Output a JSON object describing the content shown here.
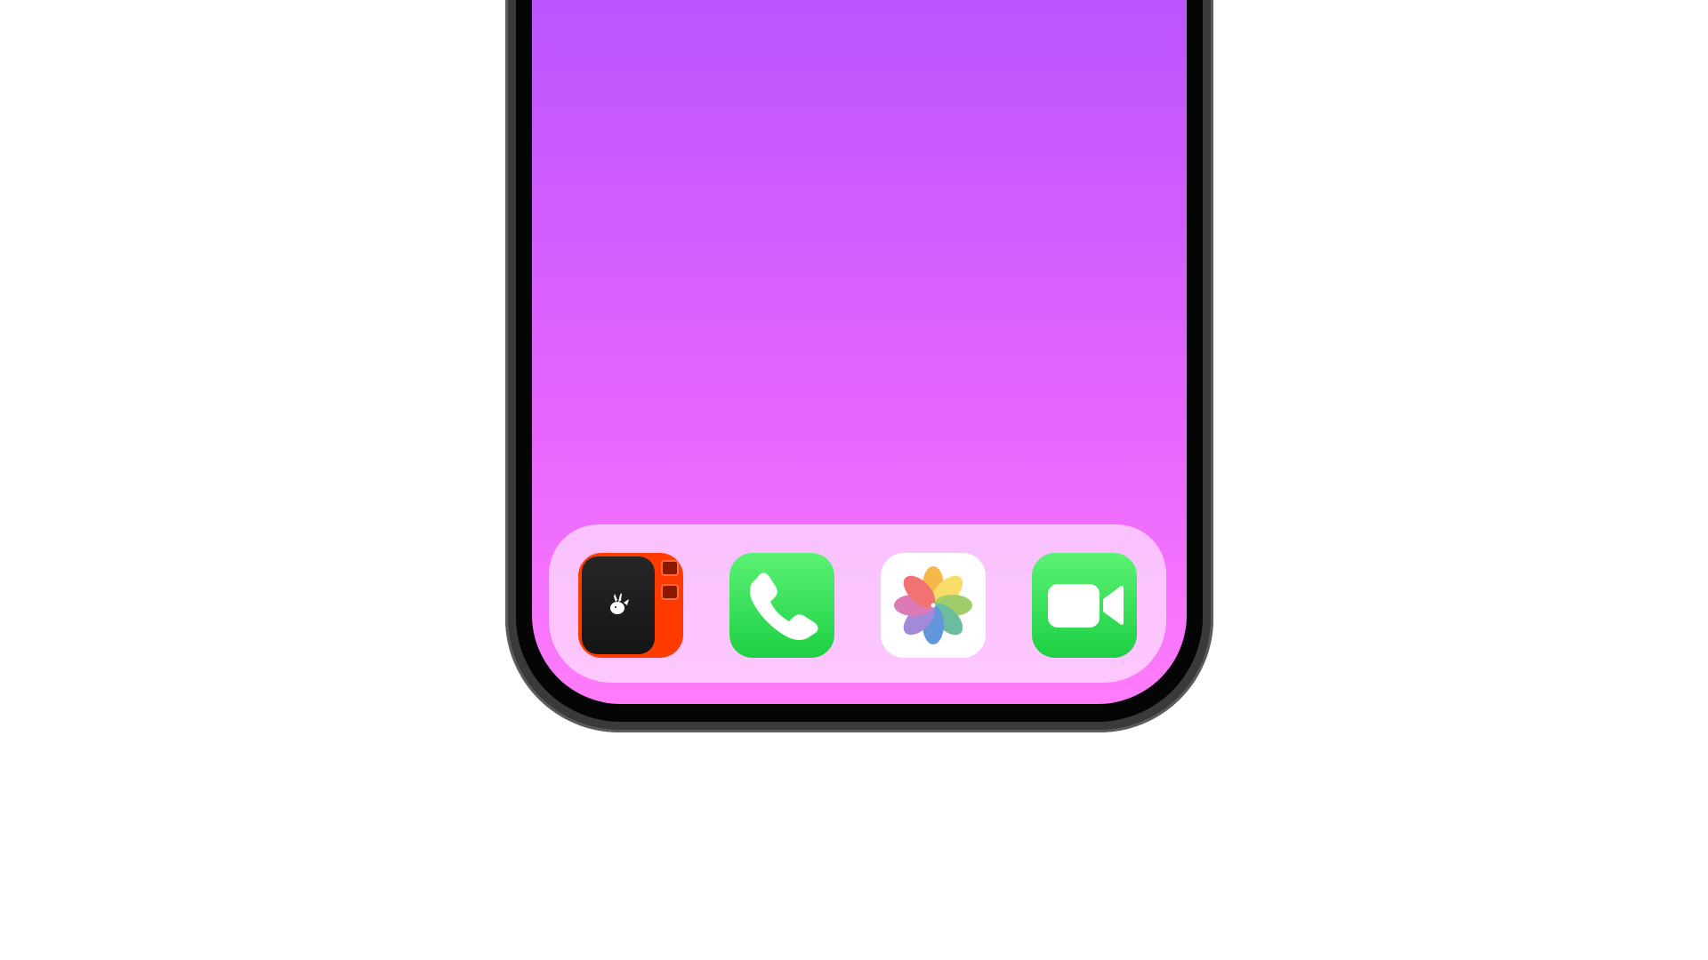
{
  "device": {
    "model": "phone",
    "frame_color": "#3a3a3a",
    "screen_gradient": [
      "#b552ff",
      "#cf5cff",
      "#e766ff",
      "#ff7cfb"
    ]
  },
  "dock": {
    "apps": [
      {
        "icon": "rabbit-r1-icon",
        "background": "#ff3b00"
      },
      {
        "icon": "phone-icon",
        "background": "#29d54a"
      },
      {
        "icon": "photos-icon",
        "background": "#ffffff"
      },
      {
        "icon": "facetime-icon",
        "background": "#29d54a"
      }
    ]
  }
}
